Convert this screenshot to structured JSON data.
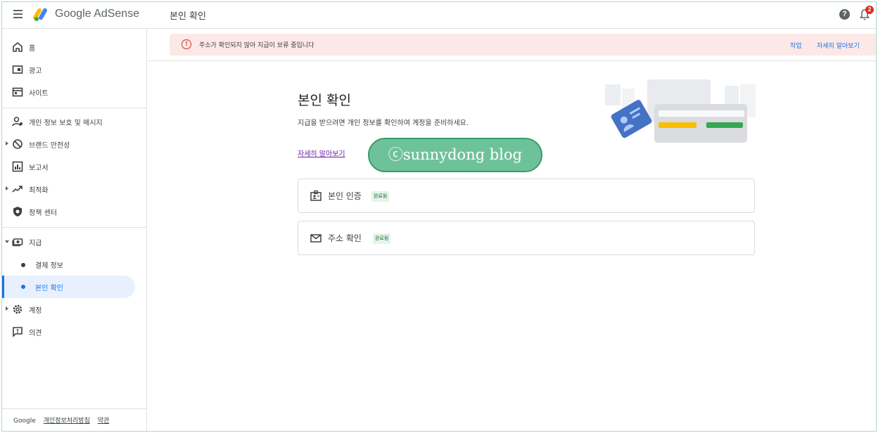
{
  "topbar": {
    "brand": "Google AdSense",
    "page_title": "본인 확인",
    "help_glyph": "?",
    "notification_count": "2",
    "colors": {
      "logo_blue": "#4285f4",
      "logo_yellow": "#fbbc04",
      "logo_green": "#34a853"
    }
  },
  "sidebar": {
    "items": [
      {
        "label": "홈",
        "icon": "home-icon"
      },
      {
        "label": "광고",
        "icon": "ads-icon"
      },
      {
        "label": "사이트",
        "icon": "sites-icon"
      },
      {
        "label": "개인 정보 보호 및 메시지",
        "icon": "privacy-icon"
      },
      {
        "label": "브랜드 안전성",
        "icon": "block-icon"
      },
      {
        "label": "보고서",
        "icon": "reports-icon"
      },
      {
        "label": "최적화",
        "icon": "trending-icon"
      },
      {
        "label": "정책 센터",
        "icon": "shield-icon"
      },
      {
        "label": "지급",
        "icon": "payments-icon"
      },
      {
        "label": "결제 정보",
        "icon": "dot"
      },
      {
        "label": "본인 확인",
        "icon": "dot"
      },
      {
        "label": "계정",
        "icon": "gear-icon"
      },
      {
        "label": "의견",
        "icon": "feedback-icon"
      }
    ],
    "active_item": "본인 확인",
    "footer": {
      "brand": "Google",
      "privacy": "개인정보처리방침",
      "terms": "약관"
    }
  },
  "alert": {
    "glyph": "!",
    "text": "주소가 확인되지 않아 지급이 보류 중입니다",
    "action": "작업",
    "learn_more": "자세히 알아보기",
    "colors": {
      "background": "#fce8e6",
      "icon": "#d93025"
    }
  },
  "main": {
    "title": "본인 확인",
    "description": "지급을 받으려면 개인 정보를 확인하여 계정을 준비하세요.",
    "learn_more": "자세히 알아보기",
    "cards": [
      {
        "title": "본인 인증",
        "status": "완료됨",
        "icon": "badge-icon"
      },
      {
        "title": "주소 확인",
        "status": "완료됨",
        "icon": "mail-icon"
      }
    ]
  },
  "watermark": {
    "text": "ⓒsunnydong blog"
  }
}
